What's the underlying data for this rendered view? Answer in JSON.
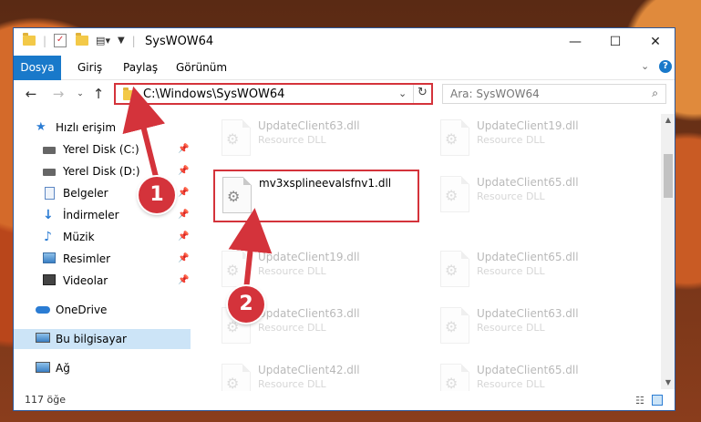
{
  "window": {
    "title": "SysWOW64",
    "minimize": "—",
    "maximize": "☐",
    "close": "✕"
  },
  "ribbon": {
    "tabs": [
      "Dosya",
      "Giriş",
      "Paylaş",
      "Görünüm"
    ]
  },
  "address": {
    "path": "C:\\Windows\\SysWOW64",
    "search_placeholder": "Ara: SysWOW64"
  },
  "nav": {
    "quick_access": "Hızlı erişim",
    "items": [
      "Yerel Disk (C:)",
      "Yerel Disk (D:)",
      "Belgeler",
      "İndirmeler",
      "Müzik",
      "Resimler",
      "Videolar"
    ],
    "onedrive": "OneDrive",
    "this_pc": "Bu bilgisayar",
    "network": "Ağ"
  },
  "files": {
    "highlighted": {
      "name": "mv3xsplineevalsfnv1.dll"
    },
    "left": [
      {
        "name": "UpdateClient63.dll",
        "desc": "Resource DLL"
      },
      {
        "name": "UpdateClient19.dll",
        "desc": "Resource DLL"
      },
      {
        "name": "UpdateClient63.dll",
        "desc": "Resource DLL"
      },
      {
        "name": "UpdateClient42.dll",
        "desc": "Resource DLL"
      }
    ],
    "right": [
      {
        "name": "UpdateClient19.dll",
        "desc": "Resource DLL"
      },
      {
        "name": "UpdateClient65.dll",
        "desc": "Resource DLL"
      },
      {
        "name": "UpdateClient65.dll",
        "desc": "Resource DLL"
      },
      {
        "name": "UpdateClient63.dll",
        "desc": "Resource DLL"
      },
      {
        "name": "UpdateClient65.dll",
        "desc": "Resource DLL"
      }
    ]
  },
  "status": {
    "count": "117 öğe"
  },
  "callouts": {
    "one": "1",
    "two": "2"
  },
  "colors": {
    "accent": "#1979ca",
    "callout": "#d4333b",
    "selection": "#cce4f7"
  }
}
